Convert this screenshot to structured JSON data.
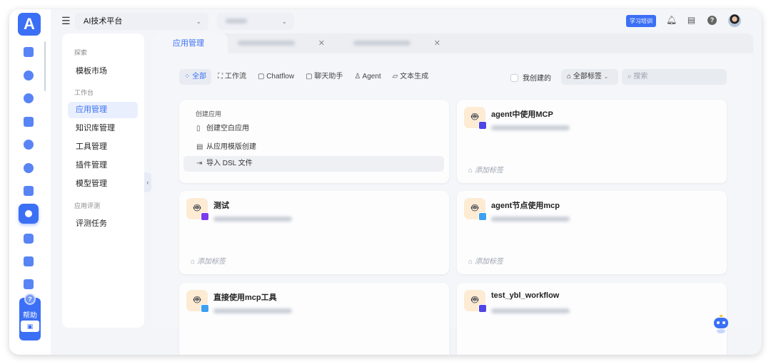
{
  "rail": {
    "logo": "A",
    "help_label": "帮助"
  },
  "topbar": {
    "platform": "AI技术平台",
    "training": "学习培训"
  },
  "sidebar": {
    "sections": [
      {
        "title": "探索",
        "items": [
          "模板市场"
        ]
      },
      {
        "title": "工作台",
        "items": [
          "应用管理",
          "知识库管理",
          "工具管理",
          "插件管理",
          "模型管理"
        ]
      },
      {
        "title": "应用评测",
        "items": [
          "评测任务"
        ]
      }
    ],
    "active": "应用管理"
  },
  "tabs": [
    {
      "label": "应用管理"
    }
  ],
  "filters": [
    "全部",
    "工作流",
    "Chatflow",
    "聊天助手",
    "Agent",
    "文本生成"
  ],
  "filter_active": "全部",
  "mine_label": "我创建的",
  "tag_select": "全部标签",
  "search_placeholder": "搜索",
  "create": {
    "header": "创建应用",
    "items": [
      "创建空白应用",
      "从应用模版创建",
      "导入 DSL 文件"
    ]
  },
  "apps": [
    {
      "name": "agent中使用MCP",
      "badge_color": "#4f46e5",
      "add_tag": "添加标签"
    },
    {
      "name": "测试",
      "badge_color": "#7c3aed",
      "add_tag": "添加标签"
    },
    {
      "name": "agent节点使用mcp",
      "badge_color": "#3ea0f0",
      "add_tag": "添加标签"
    },
    {
      "name": "直接使用mcp工具",
      "badge_color": "#3ea0f0",
      "add_tag": ""
    },
    {
      "name": "test_ybl_workflow",
      "badge_color": "#4f46e5",
      "add_tag": ""
    }
  ],
  "colors": {
    "accent": "#3b6ff5"
  }
}
